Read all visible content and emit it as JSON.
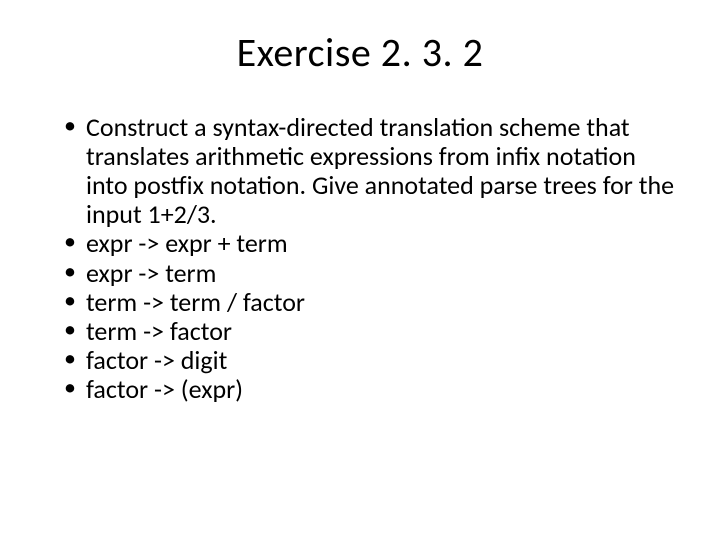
{
  "title": "Exercise 2. 3. 2",
  "bullets": [
    "Construct a syntax-directed translation scheme that translates arithmetic expressions from infix notation into postfix notation. Give annotated parse trees for the input 1+2/3.",
    "expr -> expr + term",
    "expr -> term",
    "term -> term / factor",
    "term -> factor",
    "factor -> digit",
    "factor -> (expr)"
  ]
}
